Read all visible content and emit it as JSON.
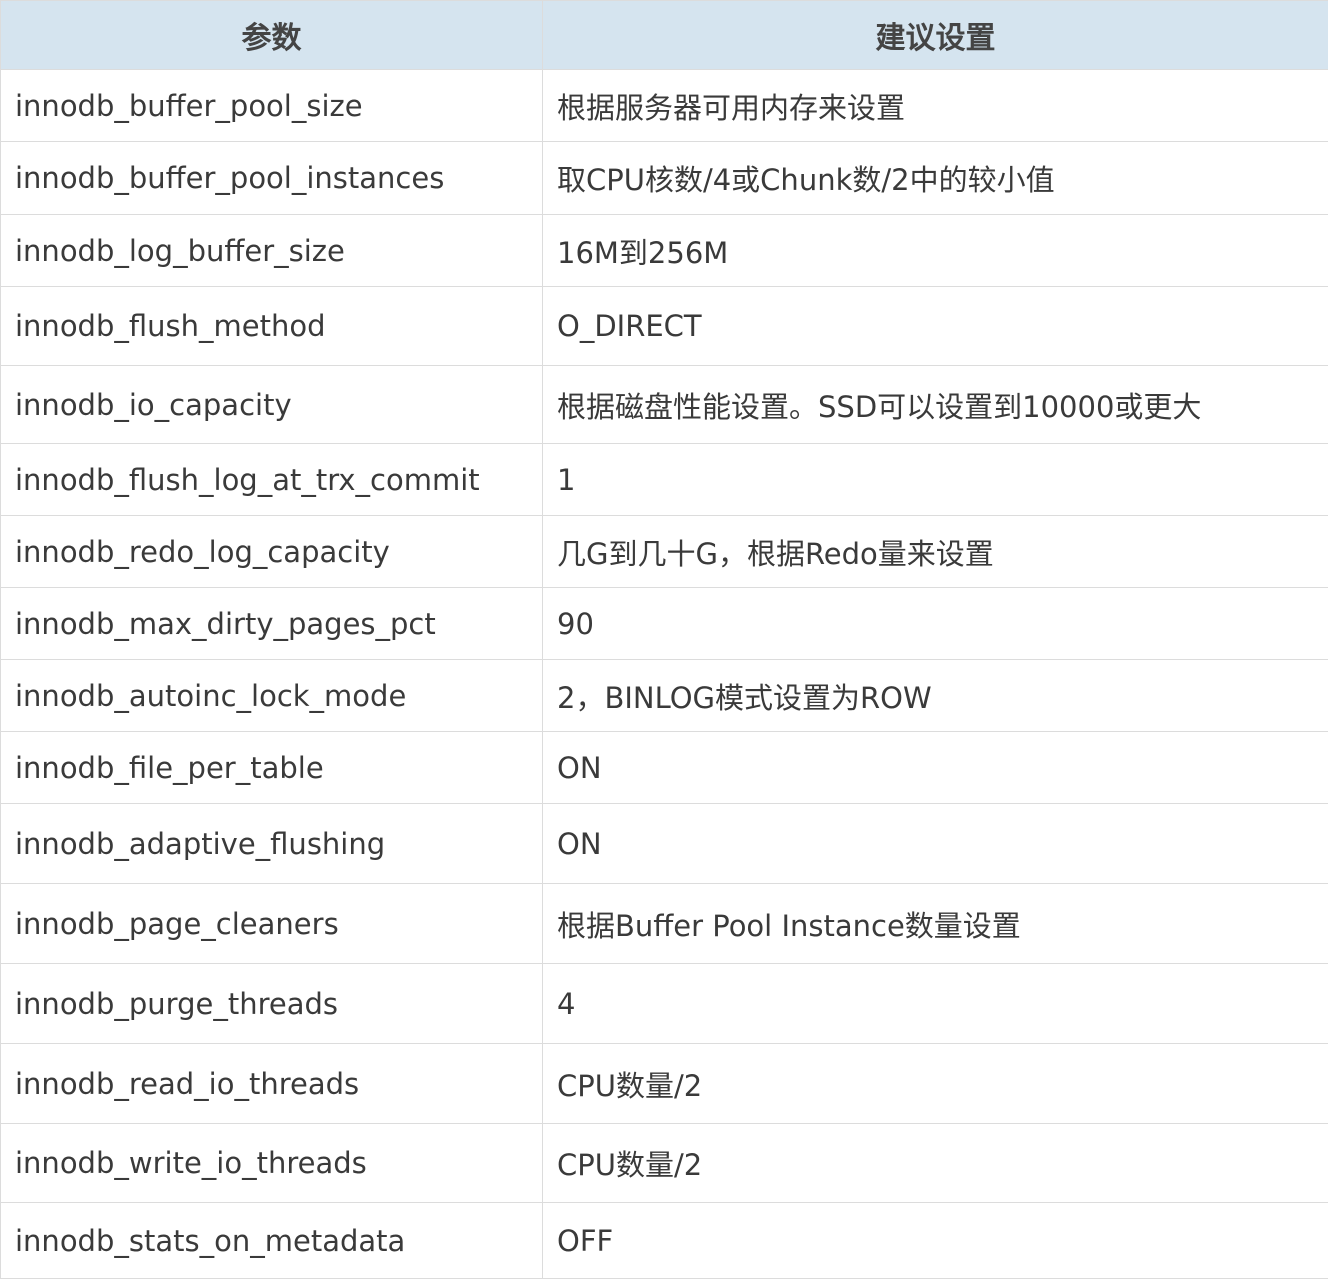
{
  "table": {
    "headers": [
      "参数",
      "建议设置"
    ],
    "rows": [
      {
        "param": "innodb_buffer_pool_size",
        "value": "根据服务器可用内存来设置"
      },
      {
        "param": "innodb_buffer_pool_instances",
        "value": "取CPU核数/4或Chunk数/2中的较小值"
      },
      {
        "param": "innodb_log_buffer_size",
        "value": "16M到256M"
      },
      {
        "param": "innodb_flush_method",
        "value": "O_DIRECT"
      },
      {
        "param": "innodb_io_capacity",
        "value": "根据磁盘性能设置。SSD可以设置到10000或更大"
      },
      {
        "param": "innodb_flush_log_at_trx_commit",
        "value": "1"
      },
      {
        "param": "innodb_redo_log_capacity",
        "value": "几G到几十G，根据Redo量来设置"
      },
      {
        "param": "innodb_max_dirty_pages_pct",
        "value": "90"
      },
      {
        "param": "innodb_autoinc_lock_mode",
        "value": "2，BINLOG模式设置为ROW"
      },
      {
        "param": "innodb_file_per_table",
        "value": "ON"
      },
      {
        "param": "innodb_adaptive_flushing",
        "value": "ON"
      },
      {
        "param": "innodb_page_cleaners",
        "value": "根据Buffer Pool Instance数量设置"
      },
      {
        "param": "innodb_purge_threads",
        "value": "4"
      },
      {
        "param": "innodb_read_io_threads",
        "value": "CPU数量/2"
      },
      {
        "param": "innodb_write_io_threads",
        "value": "CPU数量/2"
      },
      {
        "param": "innodb_stats_on_metadata",
        "value": "OFF"
      }
    ]
  }
}
